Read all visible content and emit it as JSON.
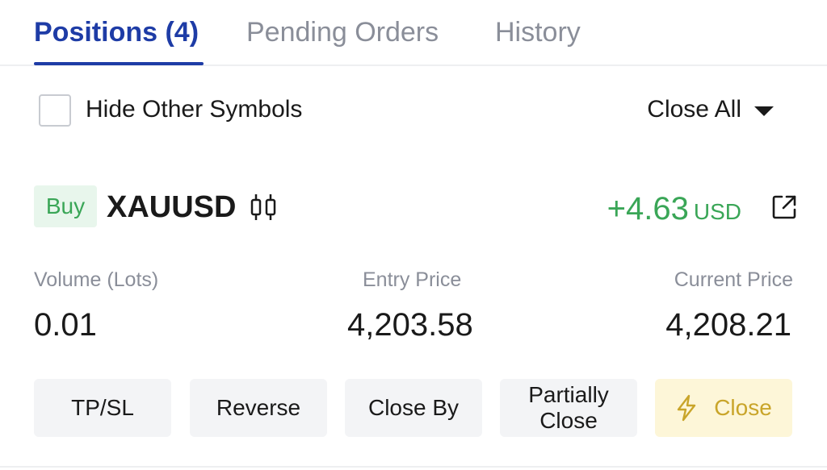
{
  "tabs": {
    "positions": "Positions (4)",
    "pending_orders": "Pending Orders",
    "history": "History"
  },
  "filter": {
    "hide_other_symbols": "Hide Other Symbols",
    "hide_other_symbols_checked": false,
    "close_all": "Close All"
  },
  "position": {
    "side": "Buy",
    "symbol": "XAUUSD",
    "pnl_value": "+4.63",
    "pnl_unit": "USD",
    "volume_label": "Volume (Lots)",
    "volume_value": "0.01",
    "entry_label": "Entry Price",
    "entry_value": "4,203.58",
    "current_label": "Current Price",
    "current_value": "4,208.21"
  },
  "actions": {
    "tp_sl": "TP/SL",
    "reverse": "Reverse",
    "close_by": "Close By",
    "partially_line1": "Partially",
    "partially_line2": "Close",
    "close": "Close"
  },
  "colors": {
    "accent_blue": "#1e3ca6",
    "profit_green": "#3aa657",
    "close_gold": "#c9a52a"
  },
  "icons": {
    "chart": "candlestick-icon",
    "share": "external-link-icon",
    "close": "lightning-icon",
    "dropdown": "caret-down-icon"
  }
}
